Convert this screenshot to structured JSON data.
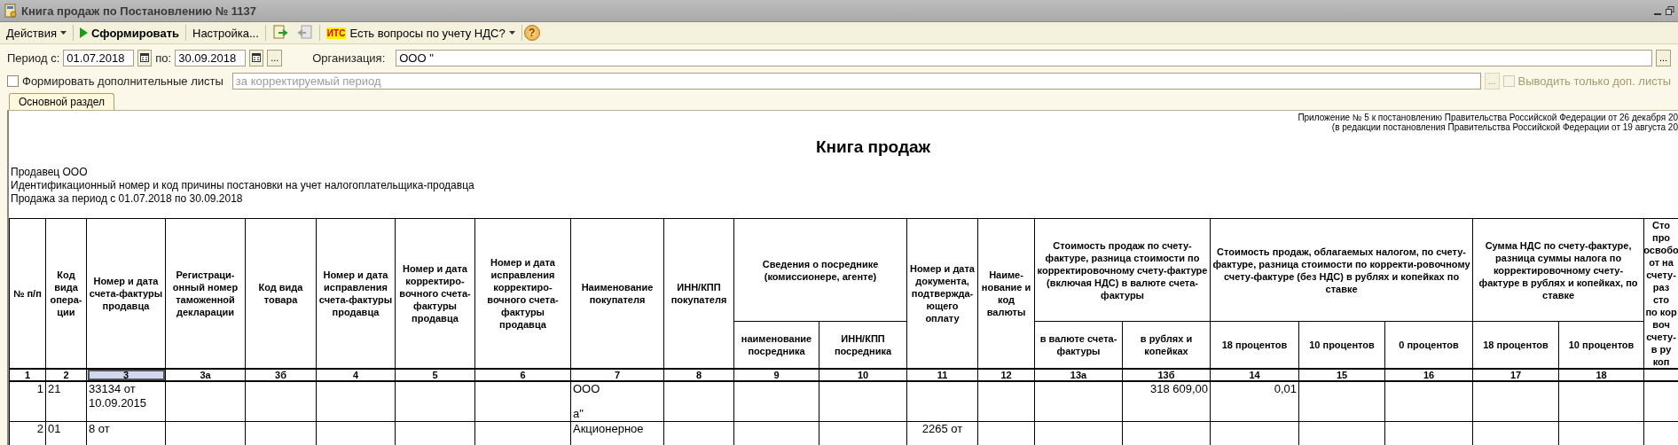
{
  "window": {
    "title": "Книга продаж по Постановлению № 1137"
  },
  "toolbar": {
    "items": [
      {
        "kind": "menu",
        "label": "Действия"
      },
      {
        "kind": "run",
        "label": "Сформировать"
      },
      {
        "kind": "button",
        "label": "Настройка..."
      },
      {
        "kind": "icons"
      },
      {
        "kind": "its",
        "badge": "ИТС",
        "label": "Есть вопросы по учету НДС?"
      },
      {
        "kind": "help",
        "label": "?"
      }
    ]
  },
  "filters": {
    "period_from_label": "Период с:",
    "period_from": "01.07.2018",
    "period_to_label": "по:",
    "period_to": "30.09.2018",
    "period_button": "...",
    "org_label": "Организация:",
    "org_value": "ООО \"",
    "org_button": "..."
  },
  "extra": {
    "checkbox_label": "Формировать дополнительные листы",
    "checked": false,
    "period_placeholder": "за корректируемый период",
    "button": "...",
    "button_disabled": true,
    "only_extra_label": "Выводить только доп. листы",
    "only_extra_checked": false,
    "only_extra_disabled": true
  },
  "tabs": [
    {
      "label": "Основной раздел",
      "selected": true
    }
  ],
  "report": {
    "notes": [
      "Приложение № 5 к постановлению Правительства Российской Федерации от 26 декабря 20",
      "(в редакции постановления Правительства Российской Федерации от 19 августа 20"
    ],
    "title": "Книга продаж",
    "seller_lines": [
      "Продавец  ООО",
      "Идентификационный номер и код причины постановки на учет налогоплательщика-продавца",
      "Продажа за период с 01.07.2018 по 30.09.2018"
    ],
    "table": {
      "columns": [
        {
          "label": "№ п/п"
        },
        {
          "label": "Код вида опера-ции"
        },
        {
          "label": "Номер и дата счета-фактуры продавца"
        },
        {
          "label": "Регистраци-онный номер таможенной декларации"
        },
        {
          "label": "Код вида товара"
        },
        {
          "label": "Номер и дата исправления счета-фактуры продавца"
        },
        {
          "label": "Номер и дата корректиро-вочного счета-фактуры продавца"
        },
        {
          "label": "Номер и дата исправления корректиро-вочного счета-фактуры продавца"
        },
        {
          "label": "Наименование покупателя"
        },
        {
          "label": "ИНН/КПП покупателя"
        },
        {
          "group": "Сведения о посреднике (комиссионере, агенте)",
          "children": [
            {
              "label": "наименование посредника"
            },
            {
              "label": "ИНН/КПП посредника"
            }
          ]
        },
        {
          "label": "Номер и дата документа, подтвержда-ющего оплату"
        },
        {
          "label": "Наиме-нование и код валюты"
        },
        {
          "group": "Стоимость продаж по счету-фактуре, разница стоимости по корректировочному счету-фактуре (включая НДС) в валюте счета-фактуры",
          "children": [
            {
              "label": "в валюте счета-фактуры"
            },
            {
              "label": "в рублях и копейках"
            }
          ]
        },
        {
          "group": "Стоимость продаж, облагаемых налогом, по счету-фактуре, разница стоимости по корректи-ровочному счету-фактуре (без НДС) в рублях и копейках по ставке",
          "children": [
            {
              "label": "18 процентов"
            },
            {
              "label": "10 процентов"
            },
            {
              "label": "0 процентов"
            }
          ]
        },
        {
          "group": "Сумма НДС по счету-фактуре, разница суммы налога по корректировочному счету-фактуре в рублях и копейках, по ставке",
          "children": [
            {
              "label": "18 процентов"
            },
            {
              "label": "10 процентов"
            }
          ]
        },
        {
          "label_lines": [
            "Сто",
            "про",
            "освобо",
            "от на",
            "счету-",
            "раз",
            "сто",
            "по кор",
            "воч",
            "счету-",
            "в ру",
            "коп"
          ]
        }
      ],
      "numbers": [
        {
          "label": "1",
          "selected": false
        },
        {
          "label": "2",
          "selected": false
        },
        {
          "label": "3",
          "selected": true
        },
        {
          "label": "3а",
          "selected": false
        },
        {
          "label": "3б",
          "selected": false
        },
        {
          "label": "4",
          "selected": false
        },
        {
          "label": "5",
          "selected": false
        },
        {
          "label": "6",
          "selected": false
        },
        {
          "label": "7",
          "selected": false
        },
        {
          "label": "8",
          "selected": false
        },
        {
          "label": "9",
          "selected": false
        },
        {
          "label": "10",
          "selected": false
        },
        {
          "label": "11",
          "selected": false
        },
        {
          "label": "12",
          "selected": false
        },
        {
          "label": "13а",
          "selected": false
        },
        {
          "label": "13б",
          "selected": false
        },
        {
          "label": "14",
          "selected": false
        },
        {
          "label": "15",
          "selected": false
        },
        {
          "label": "16",
          "selected": false
        },
        {
          "label": "17",
          "selected": false
        },
        {
          "label": "18",
          "selected": false
        }
      ],
      "rows": [
        {
          "cells": {
            "c0": "1",
            "c1": "21",
            "c2": "33134 от 10.09.2015",
            "c8": [
              "ООО",
              "а\""
            ],
            "c15": "318 609,00",
            "c16": "0,01"
          }
        },
        {
          "cells": {
            "c0": "2",
            "c1": "01",
            "c2": "8 от",
            "c8": [
              "Акционерное"
            ],
            "c12": "2265 от"
          }
        }
      ]
    }
  }
}
